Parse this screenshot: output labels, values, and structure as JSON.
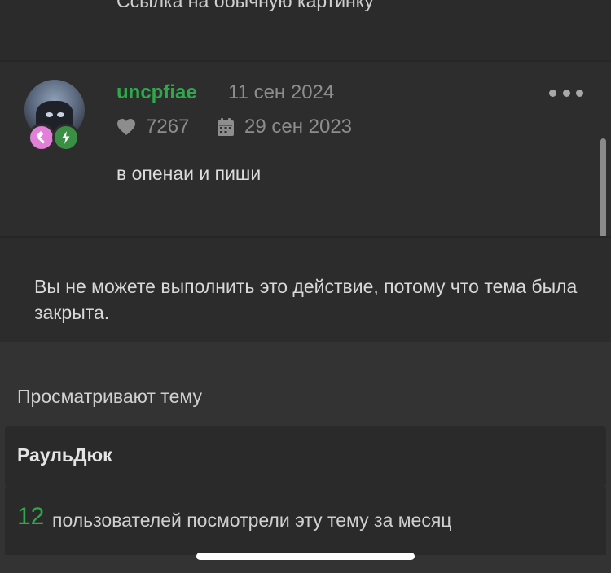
{
  "previous_post": {
    "text": "Ссылка на обычную картинку"
  },
  "post": {
    "username": "uncpfiae",
    "date": "11 сен 2024",
    "likes": "7267",
    "registered": "29 сен 2023",
    "message": "в опенаи и пиши",
    "colors": {
      "username": "#2ea84a",
      "badge_pink": "#e27fd7",
      "badge_green": "#3a8f45"
    }
  },
  "locked_notice": {
    "text": "Вы не можете выполнить это действие, потому что тема была закрыта."
  },
  "viewers": {
    "title": "Просматривают тему",
    "users": [
      "РаульДюк"
    ],
    "monthly_count": "12",
    "monthly_text": "пользователей посмотрели эту тему за месяц"
  }
}
